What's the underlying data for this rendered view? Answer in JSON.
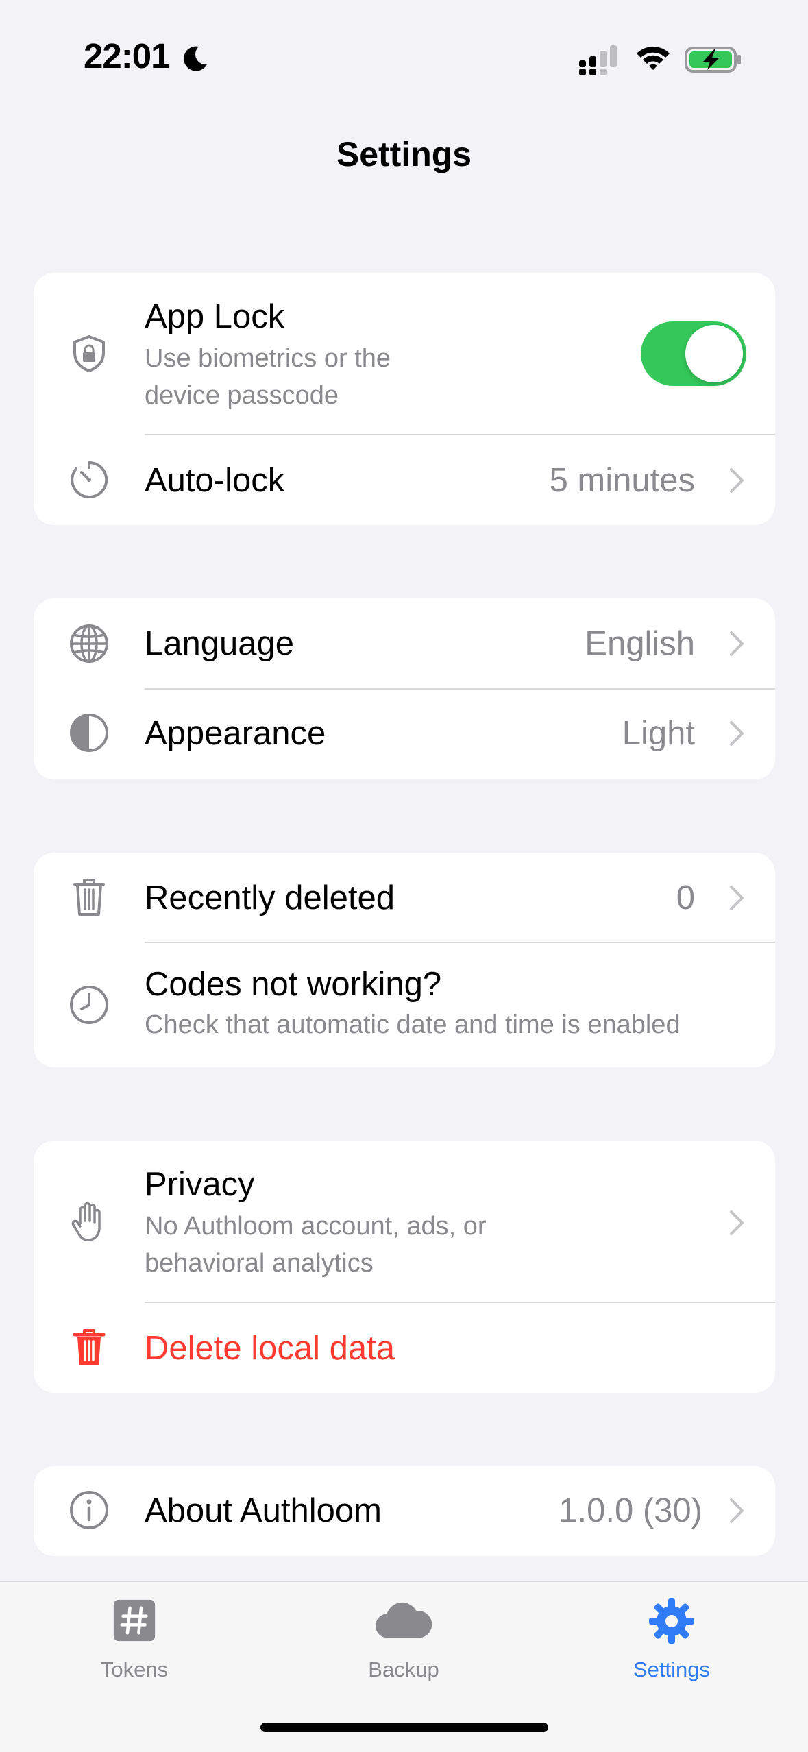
{
  "status_bar": {
    "time": "22:01",
    "icons": [
      "moon-icon",
      "cellular-signal-icon",
      "wifi-icon",
      "battery-charging-icon"
    ],
    "battery_color": "#34c759"
  },
  "nav": {
    "title": "Settings"
  },
  "groups": {
    "security": {
      "app_lock": {
        "title": "App Lock",
        "subtitle_line1": "Use biometrics or the",
        "subtitle_line2": "device passcode",
        "icon": "shield-lock-icon",
        "toggle_on": true
      },
      "auto_lock": {
        "title": "Auto-lock",
        "value": "5 minutes",
        "icon": "timer-icon"
      }
    },
    "display": {
      "language": {
        "title": "Language",
        "value": "English",
        "icon": "globe-icon"
      },
      "appearance": {
        "title": "Appearance",
        "value": "Light",
        "icon": "contrast-icon"
      }
    },
    "data": {
      "recently_deleted": {
        "title": "Recently deleted",
        "value": "0",
        "icon": "trash-icon"
      },
      "codes_not_working": {
        "title": "Codes not working?",
        "subtitle": "Check that automatic date and time is enabled",
        "icon": "clock-icon"
      }
    },
    "privacy": {
      "privacy": {
        "title": "Privacy",
        "subtitle_line1": "No Authloom account, ads, or",
        "subtitle_line2": "behavioral analytics",
        "icon": "hand-icon"
      },
      "delete_data": {
        "title": "Delete local data",
        "icon": "trash-fill-icon",
        "color": "#ff3b30"
      }
    },
    "about": {
      "about": {
        "title": "About Authloom",
        "value": "1.0.0 (30)",
        "icon": "info-icon"
      }
    }
  },
  "tab_bar": {
    "tabs": [
      {
        "label": "Tokens",
        "icon": "hash-square-icon",
        "active": false
      },
      {
        "label": "Backup",
        "icon": "cloud-icon",
        "active": false
      },
      {
        "label": "Settings",
        "icon": "gear-icon",
        "active": true
      }
    ],
    "active_color": "#2f7cf6",
    "inactive_color": "#8a8a8e"
  }
}
